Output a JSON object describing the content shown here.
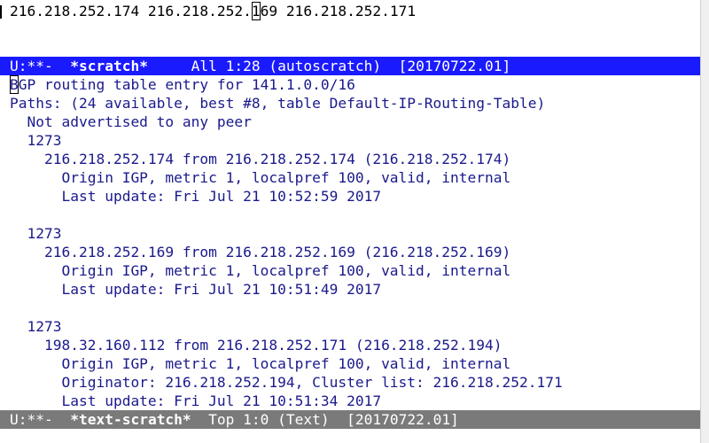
{
  "top_buffer": {
    "line_before_cursor": "216.218.252.174 216.218.252.",
    "cursor_char": "1",
    "line_after_cursor": "69 216.218.252.171"
  },
  "modeline_top": {
    "status": "U:**-  ",
    "buffer_name": "*scratch*",
    "rest": "     All 1:28 (autoscratch)  [20170722.01]"
  },
  "bottom_buffer": {
    "first_line_cursor_char": "B",
    "first_line_rest": "GP routing table entry for 141.1.0.0/16",
    "lines": [
      "Paths: (24 available, best #8, table Default-IP-Routing-Table)",
      "  Not advertised to any peer",
      "  1273",
      "    216.218.252.174 from 216.218.252.174 (216.218.252.174)",
      "      Origin IGP, metric 1, localpref 100, valid, internal",
      "      Last update: Fri Jul 21 10:52:59 2017",
      "",
      "  1273",
      "    216.218.252.169 from 216.218.252.169 (216.218.252.169)",
      "      Origin IGP, metric 1, localpref 100, valid, internal",
      "      Last update: Fri Jul 21 10:51:49 2017",
      "",
      "  1273",
      "    198.32.160.112 from 216.218.252.171 (216.218.252.194)",
      "      Origin IGP, metric 1, localpref 100, valid, internal",
      "      Originator: 216.218.252.194, Cluster list: 216.218.252.171",
      "      Last update: Fri Jul 21 10:51:34 2017"
    ]
  },
  "modeline_bottom": {
    "status": "U:**-  ",
    "buffer_name": "*text-scratch*",
    "rest": "  Top 1:0 (Text)  [20170722.01]"
  },
  "colors": {
    "active_modeline": "#1a1aff",
    "inactive_modeline": "#7a7a7a",
    "buffer_text": "#1a1a8c"
  }
}
